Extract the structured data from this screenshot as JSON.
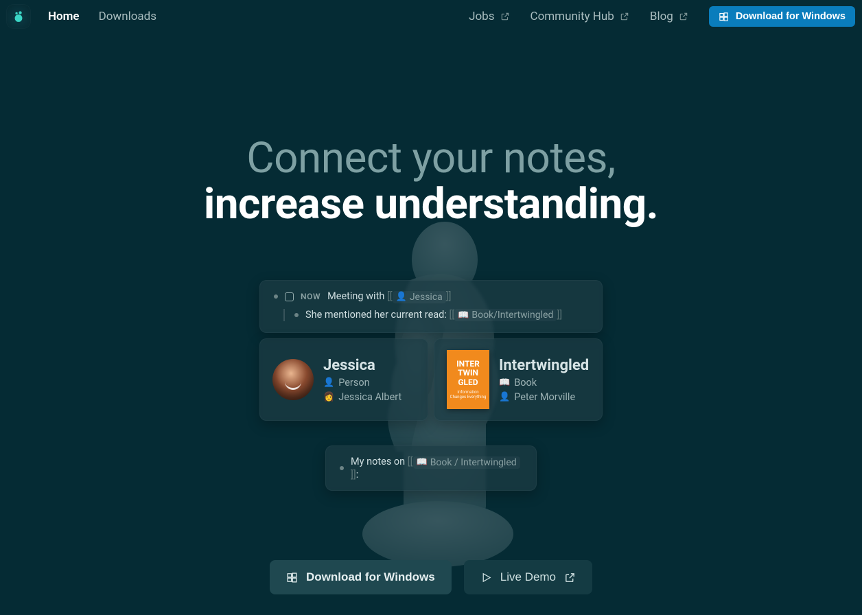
{
  "nav": {
    "home": "Home",
    "downloads": "Downloads",
    "jobs": "Jobs",
    "community": "Community Hub",
    "blog": "Blog",
    "download_btn": "Download for Windows"
  },
  "hero": {
    "line1": "Connect your notes,",
    "line2": "increase understanding."
  },
  "note_top": {
    "now": "NOW",
    "meeting_prefix": "Meeting with",
    "link_jessica": "Jessica",
    "sub_prefix": "She mentioned her current read:",
    "link_book": "Book/Intertwingled"
  },
  "profile_jessica": {
    "title": "Jessica",
    "type": "Person",
    "name": "Jessica Albert"
  },
  "profile_book": {
    "title": "Intertwingled",
    "type": "Book",
    "author": "Peter Morville",
    "cover_line1": "INTER",
    "cover_line2": "TWIN",
    "cover_line3": "GLED",
    "cover_sub": "Information Changes Everything"
  },
  "note_bottom": {
    "prefix": "My notes on",
    "link": "Book / Intertwingled",
    "suffix": ":"
  },
  "cta": {
    "download": "Download for Windows",
    "demo": "Live Demo"
  }
}
